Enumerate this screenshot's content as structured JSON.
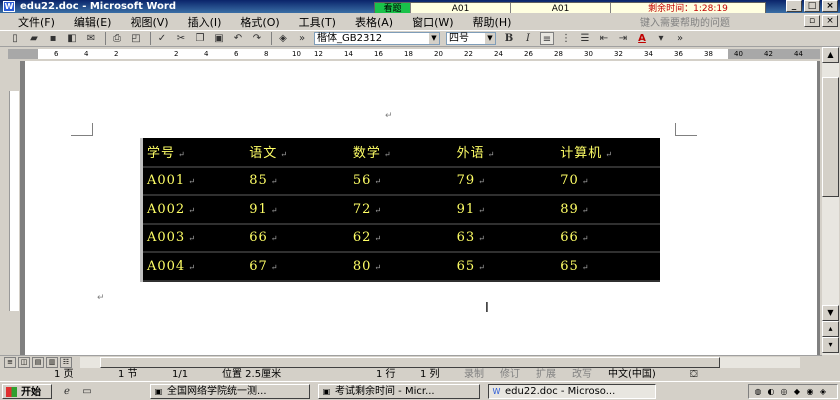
{
  "window": {
    "title": "edu22.doc - Microsoft Word",
    "controls": {
      "minimize": "_",
      "maximize": "□",
      "close": "×"
    }
  },
  "exam_bar": {
    "tab": "看题",
    "cell1": "A01",
    "cell2": "A01",
    "timer": "剩余时间：1:28:19"
  },
  "menu": {
    "items": [
      "文件(F)",
      "编辑(E)",
      "视图(V)",
      "插入(I)",
      "格式(O)",
      "工具(T)",
      "表格(A)",
      "窗口(W)",
      "帮助(H)"
    ],
    "help_hint": "键入需要帮助的问题"
  },
  "toolbar": {
    "font_name": "楷体_GB2312",
    "font_size": "四号",
    "bold": "B",
    "italic": "I",
    "underline": "U",
    "font_color": "A"
  },
  "ruler": {
    "numbers": [
      "6",
      "4",
      "2",
      "",
      "2",
      "4",
      "6",
      "8",
      "10",
      "12",
      "14",
      "16",
      "18",
      "20",
      "22",
      "24",
      "26",
      "28",
      "30",
      "32",
      "34",
      "36",
      "38",
      "40",
      "42",
      "44"
    ]
  },
  "table": {
    "header": [
      "学号",
      "语文",
      "数学",
      "外语",
      "计算机"
    ],
    "rows": [
      [
        "A001",
        "85",
        "56",
        "79",
        "70"
      ],
      [
        "A002",
        "91",
        "72",
        "91",
        "89"
      ],
      [
        "A003",
        "66",
        "62",
        "63",
        "66"
      ],
      [
        "A004",
        "67",
        "80",
        "65",
        "65"
      ]
    ],
    "cell_mark": "↵"
  },
  "status": {
    "page": "1 页",
    "section": "1 节",
    "page_of": "1/1",
    "position": "位置 2.5厘米",
    "line": "1 行",
    "column": "1 列",
    "rec": "录制",
    "trk": "修订",
    "ext": "扩展",
    "ovr": "改写",
    "language": "中文(中国)"
  },
  "taskbar": {
    "start": "开始",
    "tasks": [
      "全国网络学院统一测...",
      "考试剩余时间 - Micr...",
      "edu22.doc - Microso..."
    ]
  }
}
